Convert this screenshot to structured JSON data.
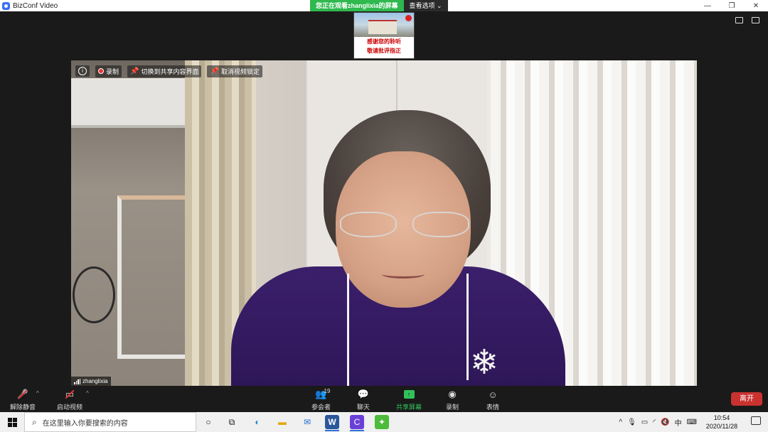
{
  "window": {
    "title": "BizConf Video",
    "controls": [
      "—",
      "❐",
      "✕"
    ]
  },
  "banner": {
    "viewing": "您正在观看zhanglixia的屏幕",
    "options": "查看选项 ⌄"
  },
  "shared_slide": {
    "line1": "感谢您的聆听",
    "line2": "敬请批评指正"
  },
  "video_toolbar": {
    "record": "录制",
    "switch_to_share": "切换到共享内容界面",
    "unpin_video": "取消视频锁定"
  },
  "participant": {
    "name": "zhanglixia"
  },
  "controls": {
    "unmute": "解除静音",
    "start_video": "启动视频",
    "participants": "参会者",
    "participant_count": "19",
    "chat": "聊天",
    "share_screen": "共享屏幕",
    "record": "录制",
    "reactions": "表情",
    "leave": "离开"
  },
  "taskbar": {
    "search_placeholder": "在这里输入你要搜索的内容",
    "ime": "中",
    "time": "10:54",
    "date": "2020/11/28"
  },
  "colors": {
    "share_green": "#32c25a",
    "banner_green": "#2fb84e",
    "leave_red": "#c9322f",
    "brand_blue": "#3d6ff2"
  }
}
